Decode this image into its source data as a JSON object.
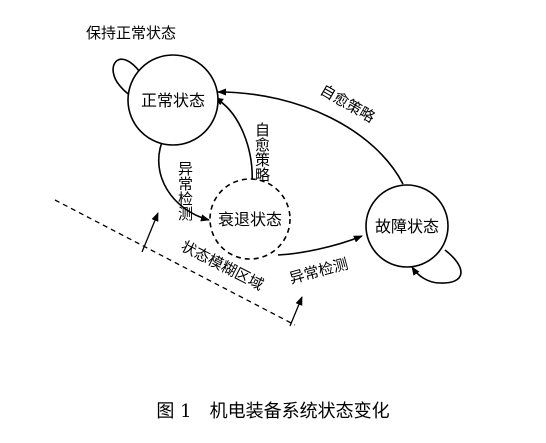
{
  "nodes": {
    "normal": {
      "label": "正常状态"
    },
    "degraded": {
      "label": "衰退状态"
    },
    "fault": {
      "label": "故障状态"
    }
  },
  "edges": {
    "normal_self": {
      "label": "保持正常状态"
    },
    "normal_to_degraded": {
      "label": "异常检测"
    },
    "degraded_to_normal": {
      "label": "自愈策略"
    },
    "fault_to_normal": {
      "label": "自愈策略"
    },
    "degraded_to_fault": {
      "label": "异常检测"
    }
  },
  "fuzzy_region": {
    "label": "状态模糊区域"
  },
  "caption": {
    "label": "图 1　机电装备系统状态变化"
  }
}
